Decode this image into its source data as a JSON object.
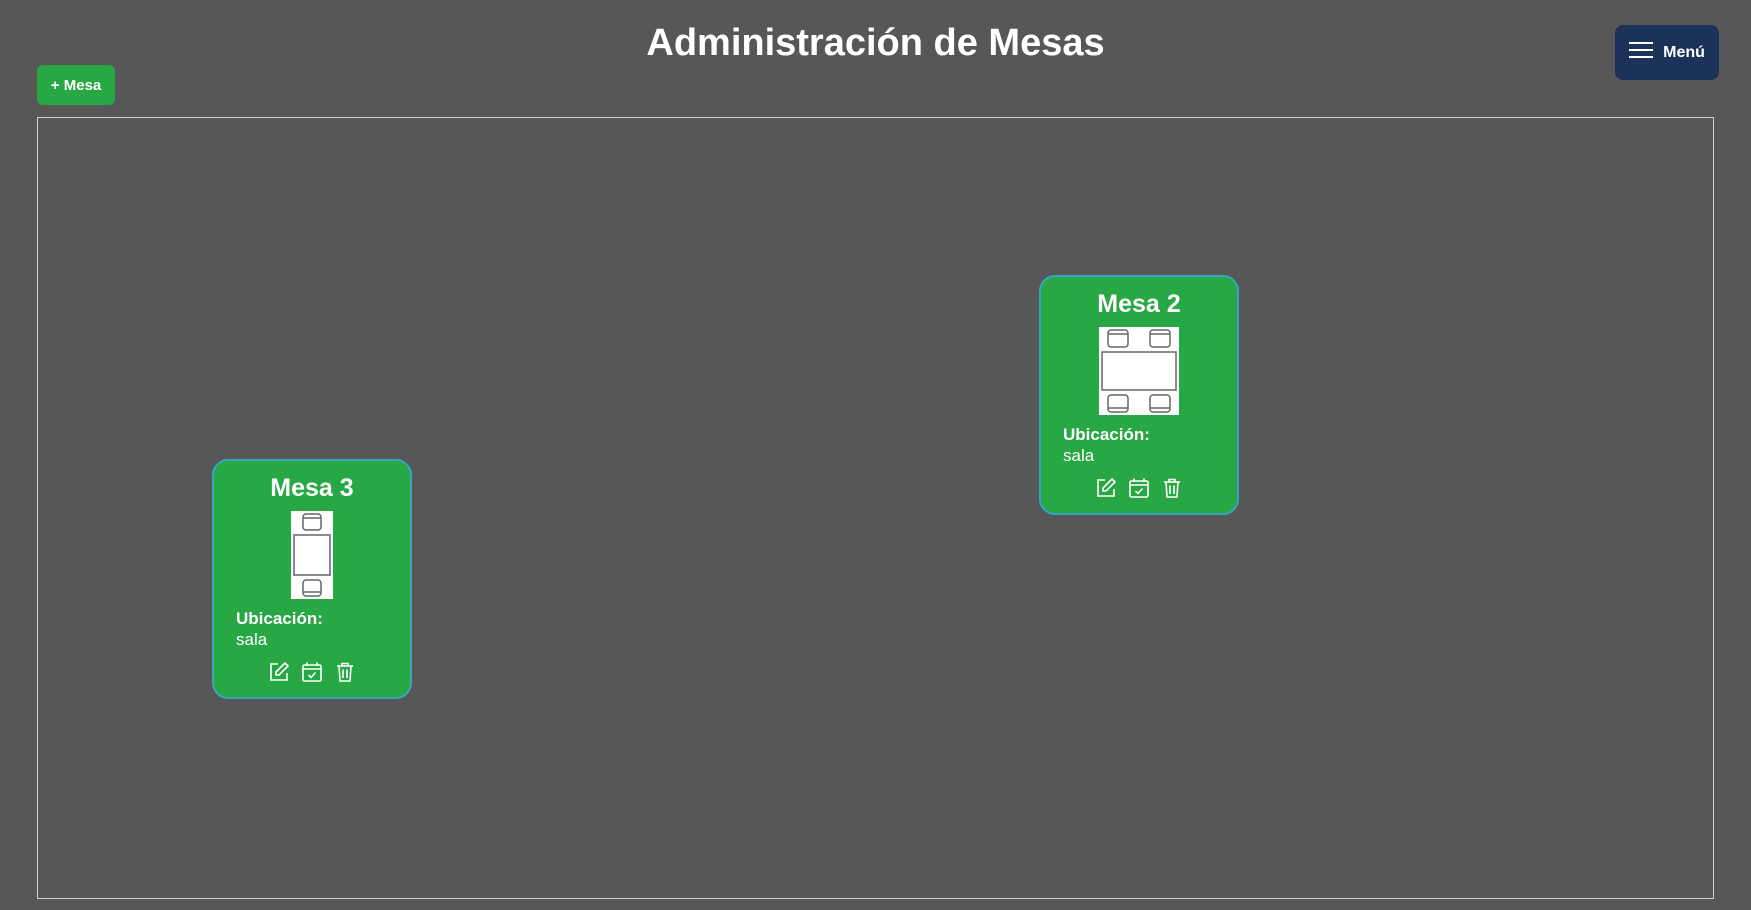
{
  "header": {
    "title": "Administración de Mesas",
    "add_label": "+ Mesa",
    "menu_label": "Menú"
  },
  "colors": {
    "background": "#575757",
    "card": "#28a745",
    "card_border": "#3aa3c0",
    "menu_button": "#1b3358"
  },
  "tables": [
    {
      "name": "Mesa 3",
      "location_label": "Ubicación:",
      "location": "sala",
      "seats": 2,
      "actions": [
        "edit-icon",
        "calendar-check-icon",
        "trash-icon"
      ]
    },
    {
      "name": "Mesa 2",
      "location_label": "Ubicación:",
      "location": "sala",
      "seats": 4,
      "actions": [
        "edit-icon",
        "calendar-check-icon",
        "trash-icon"
      ]
    }
  ]
}
